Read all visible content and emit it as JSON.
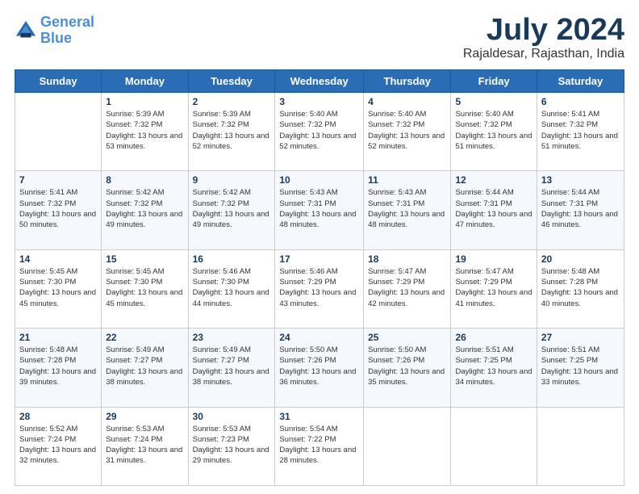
{
  "header": {
    "logo_line1": "General",
    "logo_line2": "Blue",
    "month": "July 2024",
    "location": "Rajaldesar, Rajasthan, India"
  },
  "days": [
    "Sunday",
    "Monday",
    "Tuesday",
    "Wednesday",
    "Thursday",
    "Friday",
    "Saturday"
  ],
  "weeks": [
    [
      {
        "date": "",
        "sunrise": "",
        "sunset": "",
        "daylight": ""
      },
      {
        "date": "1",
        "sunrise": "Sunrise: 5:39 AM",
        "sunset": "Sunset: 7:32 PM",
        "daylight": "Daylight: 13 hours and 53 minutes."
      },
      {
        "date": "2",
        "sunrise": "Sunrise: 5:39 AM",
        "sunset": "Sunset: 7:32 PM",
        "daylight": "Daylight: 13 hours and 52 minutes."
      },
      {
        "date": "3",
        "sunrise": "Sunrise: 5:40 AM",
        "sunset": "Sunset: 7:32 PM",
        "daylight": "Daylight: 13 hours and 52 minutes."
      },
      {
        "date": "4",
        "sunrise": "Sunrise: 5:40 AM",
        "sunset": "Sunset: 7:32 PM",
        "daylight": "Daylight: 13 hours and 52 minutes."
      },
      {
        "date": "5",
        "sunrise": "Sunrise: 5:40 AM",
        "sunset": "Sunset: 7:32 PM",
        "daylight": "Daylight: 13 hours and 51 minutes."
      },
      {
        "date": "6",
        "sunrise": "Sunrise: 5:41 AM",
        "sunset": "Sunset: 7:32 PM",
        "daylight": "Daylight: 13 hours and 51 minutes."
      }
    ],
    [
      {
        "date": "7",
        "sunrise": "Sunrise: 5:41 AM",
        "sunset": "Sunset: 7:32 PM",
        "daylight": "Daylight: 13 hours and 50 minutes."
      },
      {
        "date": "8",
        "sunrise": "Sunrise: 5:42 AM",
        "sunset": "Sunset: 7:32 PM",
        "daylight": "Daylight: 13 hours and 49 minutes."
      },
      {
        "date": "9",
        "sunrise": "Sunrise: 5:42 AM",
        "sunset": "Sunset: 7:32 PM",
        "daylight": "Daylight: 13 hours and 49 minutes."
      },
      {
        "date": "10",
        "sunrise": "Sunrise: 5:43 AM",
        "sunset": "Sunset: 7:31 PM",
        "daylight": "Daylight: 13 hours and 48 minutes."
      },
      {
        "date": "11",
        "sunrise": "Sunrise: 5:43 AM",
        "sunset": "Sunset: 7:31 PM",
        "daylight": "Daylight: 13 hours and 48 minutes."
      },
      {
        "date": "12",
        "sunrise": "Sunrise: 5:44 AM",
        "sunset": "Sunset: 7:31 PM",
        "daylight": "Daylight: 13 hours and 47 minutes."
      },
      {
        "date": "13",
        "sunrise": "Sunrise: 5:44 AM",
        "sunset": "Sunset: 7:31 PM",
        "daylight": "Daylight: 13 hours and 46 minutes."
      }
    ],
    [
      {
        "date": "14",
        "sunrise": "Sunrise: 5:45 AM",
        "sunset": "Sunset: 7:30 PM",
        "daylight": "Daylight: 13 hours and 45 minutes."
      },
      {
        "date": "15",
        "sunrise": "Sunrise: 5:45 AM",
        "sunset": "Sunset: 7:30 PM",
        "daylight": "Daylight: 13 hours and 45 minutes."
      },
      {
        "date": "16",
        "sunrise": "Sunrise: 5:46 AM",
        "sunset": "Sunset: 7:30 PM",
        "daylight": "Daylight: 13 hours and 44 minutes."
      },
      {
        "date": "17",
        "sunrise": "Sunrise: 5:46 AM",
        "sunset": "Sunset: 7:29 PM",
        "daylight": "Daylight: 13 hours and 43 minutes."
      },
      {
        "date": "18",
        "sunrise": "Sunrise: 5:47 AM",
        "sunset": "Sunset: 7:29 PM",
        "daylight": "Daylight: 13 hours and 42 minutes."
      },
      {
        "date": "19",
        "sunrise": "Sunrise: 5:47 AM",
        "sunset": "Sunset: 7:29 PM",
        "daylight": "Daylight: 13 hours and 41 minutes."
      },
      {
        "date": "20",
        "sunrise": "Sunrise: 5:48 AM",
        "sunset": "Sunset: 7:28 PM",
        "daylight": "Daylight: 13 hours and 40 minutes."
      }
    ],
    [
      {
        "date": "21",
        "sunrise": "Sunrise: 5:48 AM",
        "sunset": "Sunset: 7:28 PM",
        "daylight": "Daylight: 13 hours and 39 minutes."
      },
      {
        "date": "22",
        "sunrise": "Sunrise: 5:49 AM",
        "sunset": "Sunset: 7:27 PM",
        "daylight": "Daylight: 13 hours and 38 minutes."
      },
      {
        "date": "23",
        "sunrise": "Sunrise: 5:49 AM",
        "sunset": "Sunset: 7:27 PM",
        "daylight": "Daylight: 13 hours and 38 minutes."
      },
      {
        "date": "24",
        "sunrise": "Sunrise: 5:50 AM",
        "sunset": "Sunset: 7:26 PM",
        "daylight": "Daylight: 13 hours and 36 minutes."
      },
      {
        "date": "25",
        "sunrise": "Sunrise: 5:50 AM",
        "sunset": "Sunset: 7:26 PM",
        "daylight": "Daylight: 13 hours and 35 minutes."
      },
      {
        "date": "26",
        "sunrise": "Sunrise: 5:51 AM",
        "sunset": "Sunset: 7:25 PM",
        "daylight": "Daylight: 13 hours and 34 minutes."
      },
      {
        "date": "27",
        "sunrise": "Sunrise: 5:51 AM",
        "sunset": "Sunset: 7:25 PM",
        "daylight": "Daylight: 13 hours and 33 minutes."
      }
    ],
    [
      {
        "date": "28",
        "sunrise": "Sunrise: 5:52 AM",
        "sunset": "Sunset: 7:24 PM",
        "daylight": "Daylight: 13 hours and 32 minutes."
      },
      {
        "date": "29",
        "sunrise": "Sunrise: 5:53 AM",
        "sunset": "Sunset: 7:24 PM",
        "daylight": "Daylight: 13 hours and 31 minutes."
      },
      {
        "date": "30",
        "sunrise": "Sunrise: 5:53 AM",
        "sunset": "Sunset: 7:23 PM",
        "daylight": "Daylight: 13 hours and 29 minutes."
      },
      {
        "date": "31",
        "sunrise": "Sunrise: 5:54 AM",
        "sunset": "Sunset: 7:22 PM",
        "daylight": "Daylight: 13 hours and 28 minutes."
      },
      {
        "date": "",
        "sunrise": "",
        "sunset": "",
        "daylight": ""
      },
      {
        "date": "",
        "sunrise": "",
        "sunset": "",
        "daylight": ""
      },
      {
        "date": "",
        "sunrise": "",
        "sunset": "",
        "daylight": ""
      }
    ]
  ]
}
